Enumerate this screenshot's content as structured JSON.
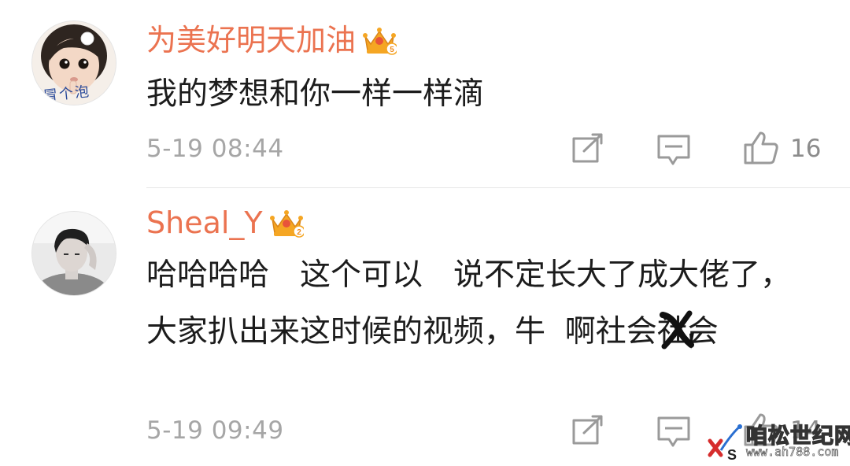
{
  "comments": [
    {
      "username": "为美好明天加油",
      "vip_level": "5",
      "avatar_caption": "冒个泡",
      "text": "我的梦想和你一样一样滴",
      "time": "5-19 08:44",
      "likes": "16"
    },
    {
      "username": "Sheal_Y",
      "vip_level": "2",
      "text": "哈哈哈哈　这个可以　说不定长大了成大佬了，大家扒出来这时候的视频，牛  啊社会社会",
      "time": "5-19 09:49",
      "likes": "14"
    }
  ],
  "watermark": {
    "title": "咱松世纪网",
    "url": "www.ah788.com"
  },
  "colors": {
    "username": "#eb7350",
    "body_text": "#1c1c1c",
    "meta_text": "#a6a6a6",
    "icon": "#9a9a9a",
    "crown": "#f5a623",
    "divider": "#e6e6e6"
  },
  "icons": [
    "crown-icon",
    "repost-icon",
    "comment-icon",
    "like-icon"
  ]
}
